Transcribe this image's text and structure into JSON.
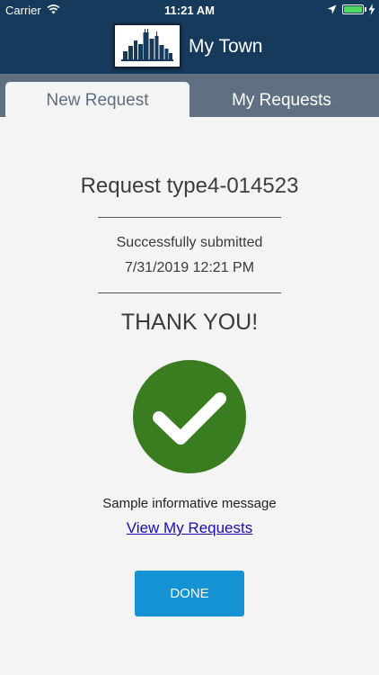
{
  "status_bar": {
    "carrier": "Carrier",
    "time": "11:21 AM"
  },
  "header": {
    "app_title": "My Town",
    "logo_icon": "city-skyline-icon"
  },
  "tabs": [
    {
      "label": "New Request",
      "active": true
    },
    {
      "label": "My Requests",
      "active": false
    }
  ],
  "confirmation": {
    "title": "Request type4-014523",
    "status": "Successfully submitted",
    "datetime": "7/31/2019 12:21 PM",
    "thanks": "THANK YOU!",
    "message": "Sample informative message",
    "link_label": "View My Requests",
    "done_label": "DONE",
    "check_icon": "checkmark-circle-icon"
  },
  "colors": {
    "header_bg": "#163a5c",
    "tabbar_bg": "#5e7082",
    "success_green": "#3a7d21",
    "done_button": "#1592d3",
    "battery_green": "#4cd964"
  }
}
